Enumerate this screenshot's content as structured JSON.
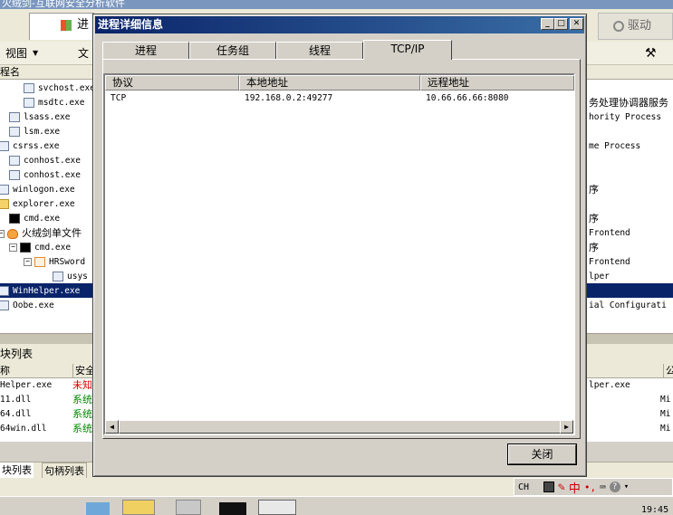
{
  "background": {
    "window_title": "火绒剑-互联网安全分析软件",
    "tab_process_partial": "进",
    "tab_driver": "驱动",
    "menu_view": "视图",
    "menu_file_partial": "文",
    "column_name_partial": "程名",
    "process_list": [
      {
        "name": "svchost.exe",
        "desc": ""
      },
      {
        "name": "msdtc.exe",
        "desc": "务处理协调器服务"
      },
      {
        "name": "lsass.exe",
        "desc": "hority Process"
      },
      {
        "name": "lsm.exe",
        "desc": ""
      },
      {
        "name": "csrss.exe",
        "desc": "me Process"
      },
      {
        "name": "conhost.exe",
        "desc": ""
      },
      {
        "name": "conhost.exe",
        "desc": ""
      },
      {
        "name": "winlogon.exe",
        "desc": "序"
      },
      {
        "name": "explorer.exe",
        "desc": ""
      },
      {
        "name": "cmd.exe",
        "desc": "序"
      },
      {
        "name": "火绒剑单文件",
        "desc": "Frontend"
      },
      {
        "name": "cmd.exe",
        "desc": "序"
      },
      {
        "name": "HRSword",
        "desc": "Frontend"
      },
      {
        "name": "usys",
        "desc": "lper"
      },
      {
        "name": "WinHelper.exe",
        "desc": ""
      },
      {
        "name": "Oobe.exe",
        "desc": "ial Configurati"
      }
    ],
    "module_panel_title": "块列表",
    "module_header_name": "称",
    "module_header_security": "安全",
    "module_header_right": "公",
    "modules": [
      {
        "name": "Helper.exe",
        "security": "未知",
        "right": "lper.exe",
        "right2": ""
      },
      {
        "name": "11.dll",
        "security": "系统",
        "right": "",
        "right2": "Mi"
      },
      {
        "name": "64.dll",
        "security": "系统",
        "right": "",
        "right2": "Mi"
      },
      {
        "name": "64win.dll",
        "security": "系统",
        "right": "",
        "right2": "Mi"
      }
    ],
    "bottom_tabs": [
      "块列表",
      "句柄列表"
    ],
    "ime_lang": "CH",
    "ime_mode": "中",
    "clock": "19:45"
  },
  "dialog": {
    "title": "进程详细信息",
    "tabs": [
      {
        "label": "进程",
        "active": false
      },
      {
        "label": "任务组",
        "active": false
      },
      {
        "label": "线程",
        "active": false
      },
      {
        "label": "TCP/IP",
        "active": true
      }
    ],
    "columns": [
      "协议",
      "本地地址",
      "远程地址"
    ],
    "connections": [
      {
        "protocol": "TCP",
        "local": "192.168.0.2:49277",
        "remote": "10.66.66.66:8080"
      }
    ],
    "close_label": "关闭"
  }
}
